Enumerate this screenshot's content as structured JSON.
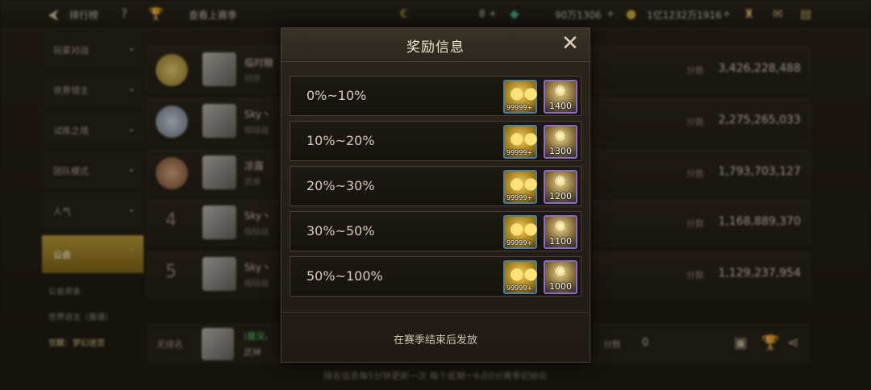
{
  "topbar": {
    "title": "排行榜",
    "help": "?",
    "view_season": "查看上赛季",
    "energy": "8",
    "silver": "90万1306",
    "gold": "1亿1232万1916"
  },
  "sidebar": {
    "items": [
      {
        "label": "玩家对战"
      },
      {
        "label": "世界领主"
      },
      {
        "label": "试炼之塔"
      },
      {
        "label": "团队模式"
      },
      {
        "label": "人气"
      },
      {
        "label": "公会"
      }
    ],
    "subitems": [
      {
        "label": "公会资金"
      },
      {
        "label": "世界领主（普通）"
      },
      {
        "label": "觉醒：梦幻迷宫"
      }
    ]
  },
  "ranking": {
    "score_label": "分数",
    "rows": [
      {
        "rank": "1",
        "name": "临时糖",
        "guild": "剑宗",
        "score": "3,426,228,488"
      },
      {
        "rank": "2",
        "name": "Sky丶",
        "guild": "暗狱战",
        "score": "2,275,265,033"
      },
      {
        "rank": "3",
        "name": "凉露",
        "guild": "武侠",
        "score": "1,793,703,127"
      },
      {
        "rank": "4",
        "name": "Sky丶",
        "guild": "暗狱战",
        "score": "1,168,889,370"
      },
      {
        "rank": "5",
        "name": "Sky丶",
        "guild": "暗狱战",
        "score": "1,129,237,954"
      }
    ]
  },
  "self": {
    "rank": "无排名",
    "name": "(魔深。",
    "guild": "武神",
    "score_label": "分数",
    "score": "0"
  },
  "footer_note": "排名信息每5分钟更新一次 每个星期一6点0分赛季初始化",
  "modal": {
    "title": "奖励信息",
    "close_icon": "close-icon",
    "tiers": [
      {
        "range": "0%~10%",
        "gold_qty": "99999+",
        "gem_qty": "1400"
      },
      {
        "range": "10%~20%",
        "gold_qty": "99999+",
        "gem_qty": "1300"
      },
      {
        "range": "20%~30%",
        "gold_qty": "99999+",
        "gem_qty": "1200"
      },
      {
        "range": "30%~50%",
        "gold_qty": "99999+",
        "gem_qty": "1100"
      },
      {
        "range": "50%~100%",
        "gold_qty": "99999+",
        "gem_qty": "1000"
      }
    ],
    "note": "在赛季结束后发放"
  }
}
